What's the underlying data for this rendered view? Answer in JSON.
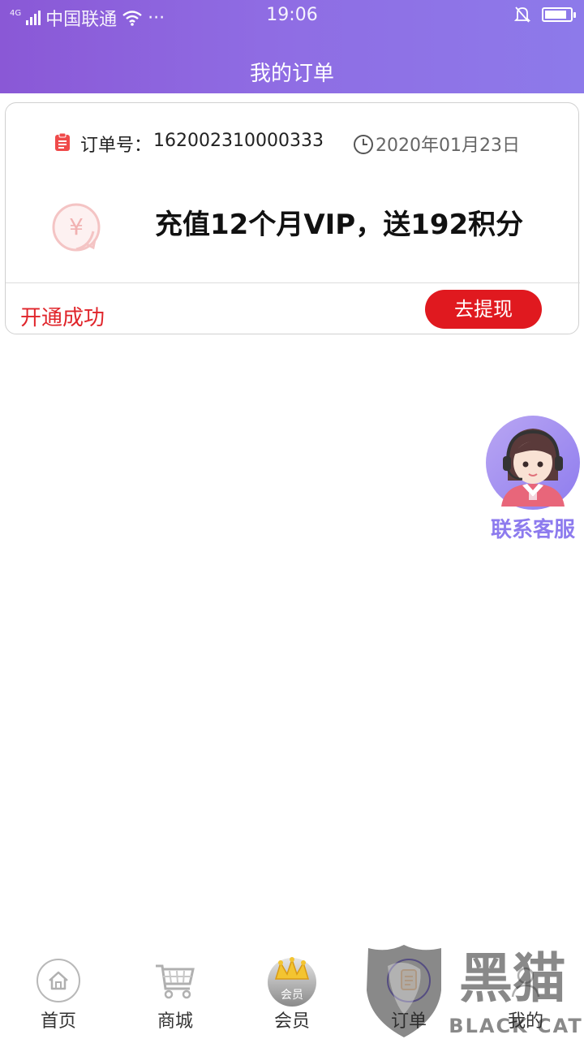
{
  "status_bar": {
    "network": "4G",
    "carrier": "中国联通",
    "more": "···",
    "time": "19:06",
    "battery_level": 0.85
  },
  "header": {
    "title": "我的订单"
  },
  "order": {
    "label": "订单号：",
    "number": "162002310000333",
    "date": "2020年01月23日",
    "product": "充值12个月VIP，送192积分",
    "status": "开通成功",
    "action": "去提现"
  },
  "customer_service": {
    "label": "联系客服"
  },
  "bottom_nav": [
    {
      "label": "首页",
      "icon": "home-icon"
    },
    {
      "label": "商城",
      "icon": "cart-icon"
    },
    {
      "label": "会员",
      "icon": "crown-icon",
      "badge": "会员"
    },
    {
      "label": "订单",
      "icon": "order-icon"
    },
    {
      "label": "我的",
      "icon": "user-icon"
    }
  ],
  "watermark": {
    "text_cn": "黑猫",
    "text_en": "BLACK CAT"
  },
  "colors": {
    "header": "#8d66dd",
    "accent_red": "#e0191f",
    "cs_purple": "#8d7bee"
  }
}
